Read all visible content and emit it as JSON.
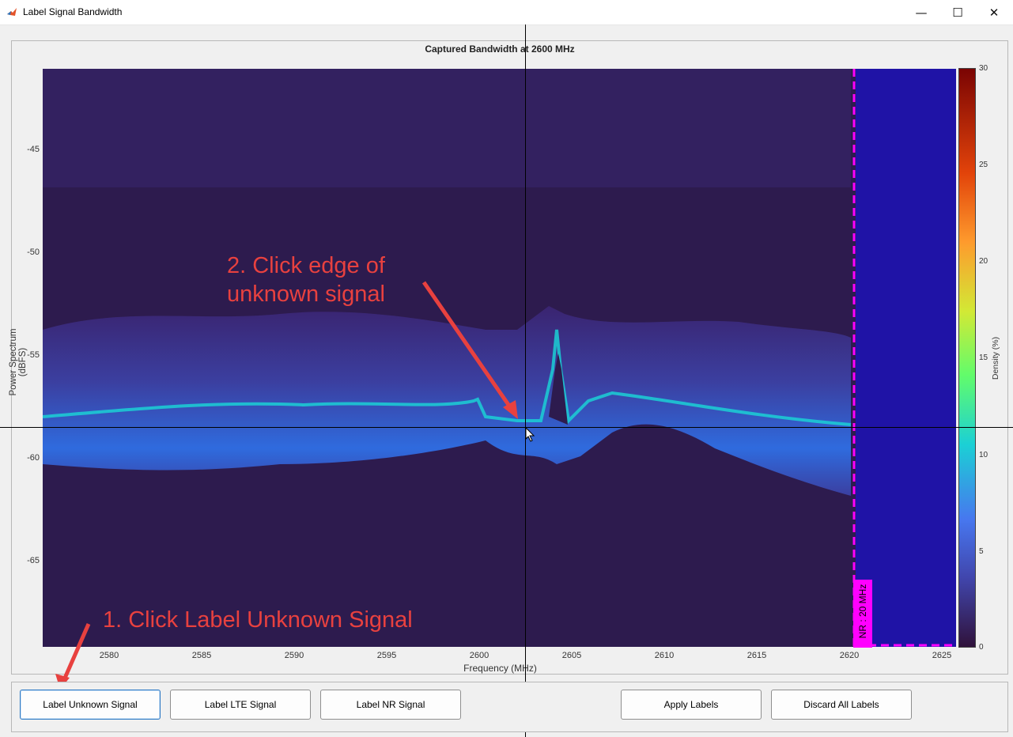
{
  "window": {
    "title": "Label Signal Bandwidth",
    "controls": {
      "minimize": "—",
      "maximize": "☐",
      "close": "✕"
    }
  },
  "plot": {
    "title": "Captured Bandwidth at 2600 MHz",
    "xlabel": "Frequency (MHz)",
    "ylabel": "Power Spectrum (dBFS)",
    "xticks": [
      "2580",
      "2585",
      "2590",
      "2595",
      "2600",
      "2605",
      "2610",
      "2615",
      "2620",
      "2625"
    ],
    "yticks": [
      "-45",
      "-50",
      "-55",
      "-60",
      "-65"
    ],
    "colorbar": {
      "label": "Density (%)",
      "ticks": [
        "30",
        "25",
        "20",
        "15",
        "10",
        "5",
        "0"
      ]
    },
    "label_tag": "NR : 20 MHz",
    "colors": {
      "background": "#2d1b4e",
      "noise": "#2f6bde",
      "peak": "#1bd0d5",
      "nr_region": "#1f13a6",
      "tag": "#ff00ff"
    }
  },
  "chart_data": {
    "type": "heatmap",
    "title": "Captured Bandwidth at 2600 MHz",
    "xlabel": "Frequency (MHz)",
    "ylabel": "Power Spectrum (dBFS)",
    "xlim": [
      2577.3,
      2626.6
    ],
    "ylim": [
      -69.3,
      -41.1
    ],
    "colorbar_label": "Density (%)",
    "colorbar_range": [
      0,
      30
    ],
    "trace": {
      "x": [
        2577.3,
        2585,
        2590,
        2595,
        2600,
        2602,
        2604,
        2605,
        2607,
        2612,
        2616,
        2619,
        2620.3
      ],
      "y": [
        -58,
        -57.5,
        -57.8,
        -57.5,
        -58,
        -58.2,
        -54.5,
        -58,
        -56.5,
        -57.5,
        -58,
        -58.3,
        -58.5
      ]
    },
    "annotations": [
      "NR : 20 MHz"
    ]
  },
  "annotations": {
    "step1": "1. Click Label Unknown Signal",
    "step2_line1": "2. Click edge of",
    "step2_line2": "unknown signal"
  },
  "buttons": {
    "label_unknown": "Label Unknown Signal",
    "label_lte": "Label LTE Signal",
    "label_nr": "Label NR Signal",
    "apply": "Apply Labels",
    "discard": "Discard All Labels"
  }
}
